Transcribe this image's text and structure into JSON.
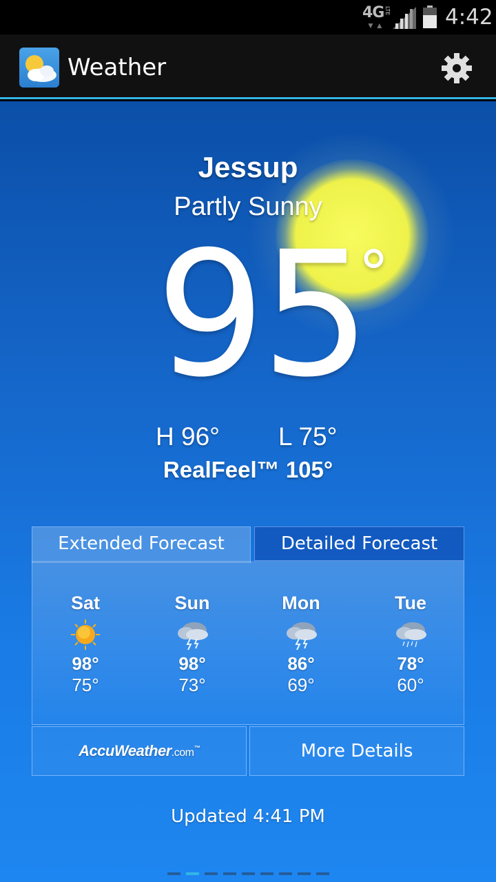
{
  "status_bar": {
    "network": "4G",
    "network_sub": "LTE",
    "time": "4:42"
  },
  "action_bar": {
    "title": "Weather",
    "settings_icon": "gear-icon"
  },
  "current": {
    "city": "Jessup",
    "condition": "Partly Sunny",
    "temperature": "95",
    "degree_symbol": "°",
    "high": "H 96°",
    "low": "L 75°",
    "realfeel": "RealFeel™ 105°"
  },
  "tabs": {
    "extended": "Extended Forecast",
    "detailed": "Detailed Forecast",
    "active": "extended"
  },
  "forecast": [
    {
      "day": "Sat",
      "icon": "sun-icon",
      "high": "98°",
      "low": "75°"
    },
    {
      "day": "Sun",
      "icon": "thunderstorm-icon",
      "high": "98°",
      "low": "73°"
    },
    {
      "day": "Mon",
      "icon": "thunderstorm-icon",
      "high": "86°",
      "low": "69°"
    },
    {
      "day": "Tue",
      "icon": "rain-cloud-icon",
      "high": "78°",
      "low": "60°"
    }
  ],
  "buttons": {
    "accuweather_logo": "AccuWeather",
    "accuweather_suffix": ".com",
    "accuweather_tm": "™",
    "more_details": "More Details"
  },
  "updated": "Updated 4:41 PM",
  "pager": {
    "pages": 9,
    "active_index": 1
  },
  "colors": {
    "accent": "#33b5e5",
    "sky_top": "#0b4fa8",
    "sky_bottom": "#1e86f0",
    "sun": "#f8fb5e"
  }
}
